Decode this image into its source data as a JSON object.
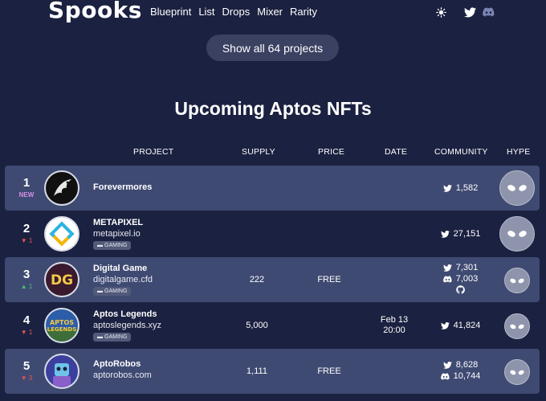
{
  "header": {
    "logo": "Spooks",
    "nav": [
      "Blueprint",
      "List",
      "Drops",
      "Mixer",
      "Rarity"
    ],
    "icons": [
      "theme-toggle-icon",
      "twitter-icon",
      "discord-icon"
    ]
  },
  "show_all_label": "Show all 64 projects",
  "title": "Upcoming Aptos NFTs",
  "columns": {
    "project": "PROJECT",
    "supply": "SUPPLY",
    "price": "PRICE",
    "date": "DATE",
    "community": "COMMUNITY",
    "hype": "HYPE"
  },
  "rows": [
    {
      "rank": "1",
      "delta": "NEW",
      "delta_dir": "new",
      "name": "Forevermores",
      "site": "",
      "tag": "",
      "supply": "",
      "price": "",
      "date": "",
      "date2": "",
      "twitter": "1,582",
      "discord": "",
      "github": false
    },
    {
      "rank": "2",
      "delta": "▼ 1",
      "delta_dir": "down",
      "name": "METAPIXEL",
      "site": "metapixel.io",
      "tag": "GAMING",
      "supply": "",
      "price": "",
      "date": "",
      "date2": "",
      "twitter": "27,151",
      "discord": "",
      "github": false
    },
    {
      "rank": "3",
      "delta": "▲ 1",
      "delta_dir": "up",
      "name": "Digital Game",
      "site": "digitalgame.cfd",
      "tag": "GAMING",
      "supply": "222",
      "price": "FREE",
      "date": "",
      "date2": "",
      "twitter": "7,301",
      "discord": "7,003",
      "github": true
    },
    {
      "rank": "4",
      "delta": "▼ 1",
      "delta_dir": "down",
      "name": "Aptos Legends",
      "site": "aptoslegends.xyz",
      "tag": "GAMING",
      "supply": "5,000",
      "price": "",
      "date": "Feb 13",
      "date2": "20:00",
      "twitter": "41,824",
      "discord": "",
      "github": false
    },
    {
      "rank": "5",
      "delta": "▼ 3",
      "delta_dir": "down",
      "name": "AptoRobos",
      "site": "aptorobos.com",
      "tag": "",
      "supply": "1,111",
      "price": "FREE",
      "date": "",
      "date2": "",
      "twitter": "8,628",
      "discord": "10,744",
      "github": false
    }
  ],
  "colors": {
    "background": "#1b2140",
    "row_highlight": "#3f4a72",
    "new": "#d590e6",
    "down": "#e25555",
    "up": "#4ec26e"
  }
}
